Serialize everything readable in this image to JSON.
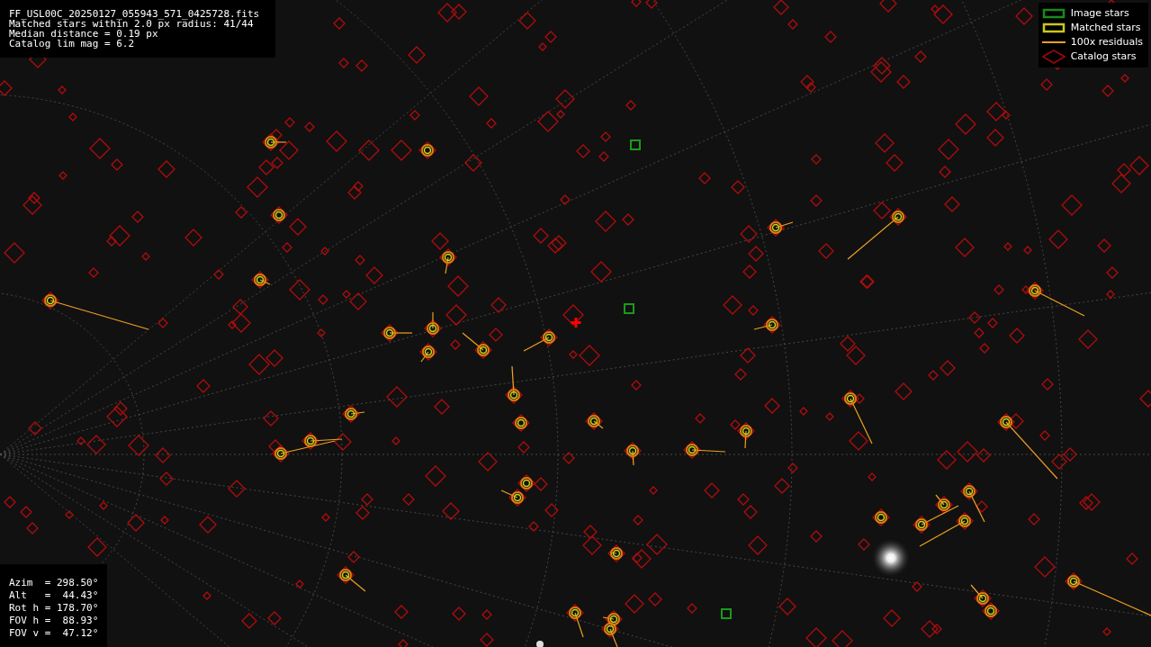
{
  "info_lines": [
    "FF_USL00C_20250127_055943_571_0425728.fits",
    "Matched stars within 2.0 px radius: 41/44",
    "Median distance = 0.19 px",
    "Catalog lim mag = 6.2"
  ],
  "legend": [
    {
      "kind": "image",
      "label": "Image stars",
      "color": "#1a8a1a"
    },
    {
      "kind": "matched",
      "label": "Matched stars",
      "color": "#c8c81e"
    },
    {
      "kind": "residual",
      "label": "100x residuals",
      "color": "#f0a020"
    },
    {
      "kind": "catalog",
      "label": "Catalog stars",
      "color": "#8b0a0a"
    }
  ],
  "pointing_lines": [
    "Azim  = 298.50°",
    "Alt   =  44.43°",
    "Rot h = 178.70°",
    "FOV h =  88.93°",
    "FOV v =  47.12°"
  ]
}
